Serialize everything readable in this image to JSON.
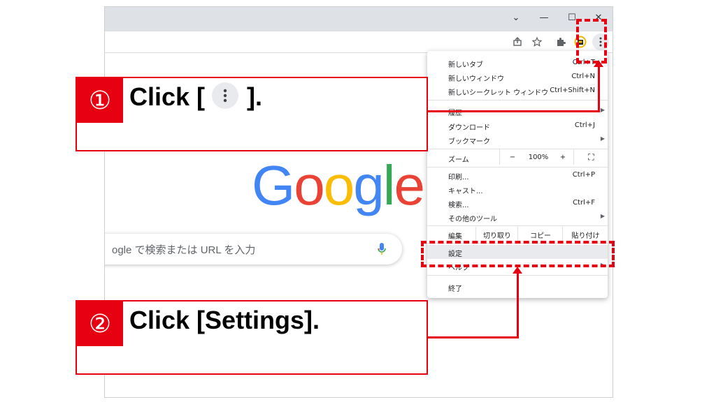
{
  "window_controls": {
    "tabs_dropdown": "⌄",
    "minimize": "—",
    "maximize": "☐",
    "close": "✕"
  },
  "toolbar_icons": [
    "share-icon",
    "bookmark-star-icon",
    "extensions-icon",
    "profile-icon",
    "more-menu-icon"
  ],
  "google_logo": {
    "letters": [
      "G",
      "o",
      "o",
      "g",
      "l",
      "e"
    ],
    "colors": [
      "#4285F4",
      "#EA4335",
      "#FBBC05",
      "#4285F4",
      "#34A853",
      "#EA4335"
    ]
  },
  "search": {
    "placeholder": "ogle で検索または URL を入力"
  },
  "menu": {
    "items_top": [
      {
        "label": "新しいタブ",
        "shortcut": "Ctrl+T"
      },
      {
        "label": "新しいウィンドウ",
        "shortcut": "Ctrl+N"
      },
      {
        "label": "新しいシークレット ウィンドウ",
        "shortcut": "Ctrl+Shift+N"
      }
    ],
    "history": "履歴",
    "downloads": {
      "label": "ダウンロード",
      "shortcut": "Ctrl+J"
    },
    "bookmarks": "ブックマーク",
    "zoom": {
      "label": "ズーム",
      "minus": "−",
      "value": "100%",
      "plus": "+",
      "fullscreen": "⛶"
    },
    "print": {
      "label": "印刷...",
      "shortcut": "Ctrl+P"
    },
    "cast": "キャスト...",
    "find": {
      "label": "検索...",
      "shortcut": "Ctrl+F"
    },
    "more_tools": "その他のツール",
    "edit": {
      "label": "編集",
      "cut": "切り取り",
      "copy": "コピー",
      "paste": "貼り付け"
    },
    "settings": "設定",
    "help": "ヘルプ",
    "exit": "終了"
  },
  "callouts": [
    {
      "number": "①",
      "text_before": "Click [",
      "text_after": "]."
    },
    {
      "number": "②",
      "text": "Click [Settings]."
    }
  ],
  "accent_color": "#e60012"
}
